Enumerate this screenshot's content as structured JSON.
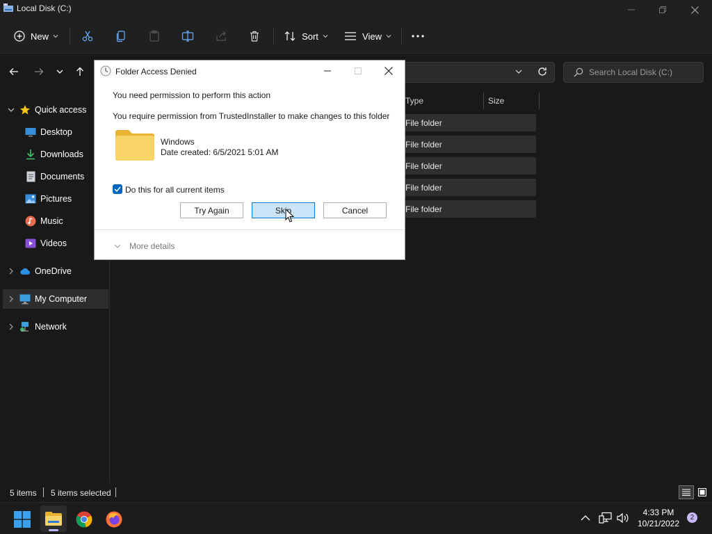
{
  "window": {
    "title": "Local Disk (C:)"
  },
  "toolbar": {
    "new_label": "New",
    "sort_label": "Sort",
    "view_label": "View"
  },
  "search": {
    "placeholder": "Search Local Disk (C:)"
  },
  "sidebar": {
    "items": [
      {
        "label": "Quick access",
        "icon": "star-icon"
      },
      {
        "label": "Desktop",
        "icon": "desktop-icon"
      },
      {
        "label": "Downloads",
        "icon": "download-icon"
      },
      {
        "label": "Documents",
        "icon": "document-icon"
      },
      {
        "label": "Pictures",
        "icon": "picture-icon"
      },
      {
        "label": "Music",
        "icon": "music-icon"
      },
      {
        "label": "Videos",
        "icon": "video-icon"
      },
      {
        "label": "OneDrive",
        "icon": "cloud-icon"
      },
      {
        "label": "My Computer",
        "icon": "computer-icon"
      },
      {
        "label": "Network",
        "icon": "network-icon"
      }
    ]
  },
  "list": {
    "columns": {
      "type": "Type",
      "size": "Size"
    },
    "rows": [
      {
        "type": "File folder"
      },
      {
        "type": "File folder"
      },
      {
        "type": "File folder"
      },
      {
        "type": "File folder"
      },
      {
        "type": "File folder"
      }
    ]
  },
  "dialog": {
    "title": "Folder Access Denied",
    "line1": "You need permission to perform this action",
    "line2": "You require permission from TrustedInstaller to make changes to this folder",
    "folder_name": "Windows",
    "folder_date": "Date created: 6/5/2021 5:01 AM",
    "checkbox_label": "Do this for all current items",
    "checkbox_checked": true,
    "try_again_label": "Try Again",
    "skip_label": "Skip",
    "cancel_label": "Cancel",
    "more_details_label": "More details"
  },
  "status": {
    "items_count": "5 items",
    "selected_count": "5 items selected"
  },
  "taskbar": {
    "time": "4:33 PM",
    "date": "10/21/2022",
    "notification_count": "2"
  },
  "colors": {
    "accent": "#0067c0",
    "folder": "#f7c948"
  }
}
